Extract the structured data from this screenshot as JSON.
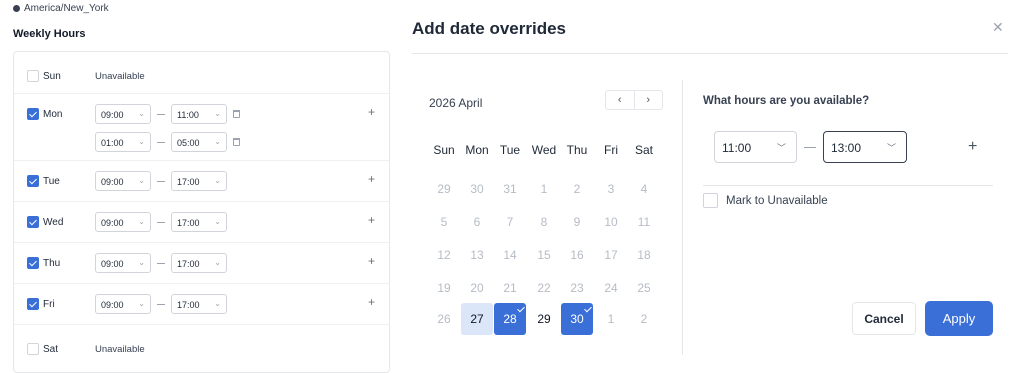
{
  "weekly": {
    "timezone": "America/New_York",
    "title": "Weekly Hours",
    "unavailable_label": "Unavailable",
    "days": [
      {
        "label": "Sun",
        "enabled": false,
        "ranges": []
      },
      {
        "label": "Mon",
        "enabled": true,
        "ranges": [
          {
            "from": "09:00",
            "to": "11:00"
          },
          {
            "from": "01:00",
            "to": "05:00"
          }
        ]
      },
      {
        "label": "Tue",
        "enabled": true,
        "ranges": [
          {
            "from": "09:00",
            "to": "17:00"
          }
        ]
      },
      {
        "label": "Wed",
        "enabled": true,
        "ranges": [
          {
            "from": "09:00",
            "to": "17:00"
          }
        ]
      },
      {
        "label": "Thu",
        "enabled": true,
        "ranges": [
          {
            "from": "09:00",
            "to": "17:00"
          }
        ]
      },
      {
        "label": "Fri",
        "enabled": true,
        "ranges": [
          {
            "from": "09:00",
            "to": "17:00"
          }
        ]
      },
      {
        "label": "Sat",
        "enabled": false,
        "ranges": []
      }
    ]
  },
  "overrides": {
    "title": "Add date overrides",
    "calendar": {
      "month_label": "2026 April",
      "weekdays": [
        "Sun",
        "Mon",
        "Tue",
        "Wed",
        "Thu",
        "Fri",
        "Sat"
      ],
      "weeks": [
        [
          "29",
          "30",
          "31",
          "1",
          "2",
          "3",
          "4"
        ],
        [
          "5",
          "6",
          "7",
          "8",
          "9",
          "10",
          "11"
        ],
        [
          "12",
          "13",
          "14",
          "15",
          "16",
          "17",
          "18"
        ],
        [
          "19",
          "20",
          "21",
          "22",
          "23",
          "24",
          "25"
        ],
        [
          "26",
          "27",
          "28",
          "29",
          "30",
          "1",
          "2"
        ]
      ],
      "today": "27",
      "selected": [
        "28",
        "30"
      ]
    },
    "question": "What hours are you available?",
    "from_time": "11:00",
    "to_time": "13:00",
    "mark_unavailable_label": "Mark to Unavailable",
    "cancel_label": "Cancel",
    "apply_label": "Apply"
  },
  "colors": {
    "accent": "#3b6fd8",
    "today_bg": "#dbe6f8"
  }
}
